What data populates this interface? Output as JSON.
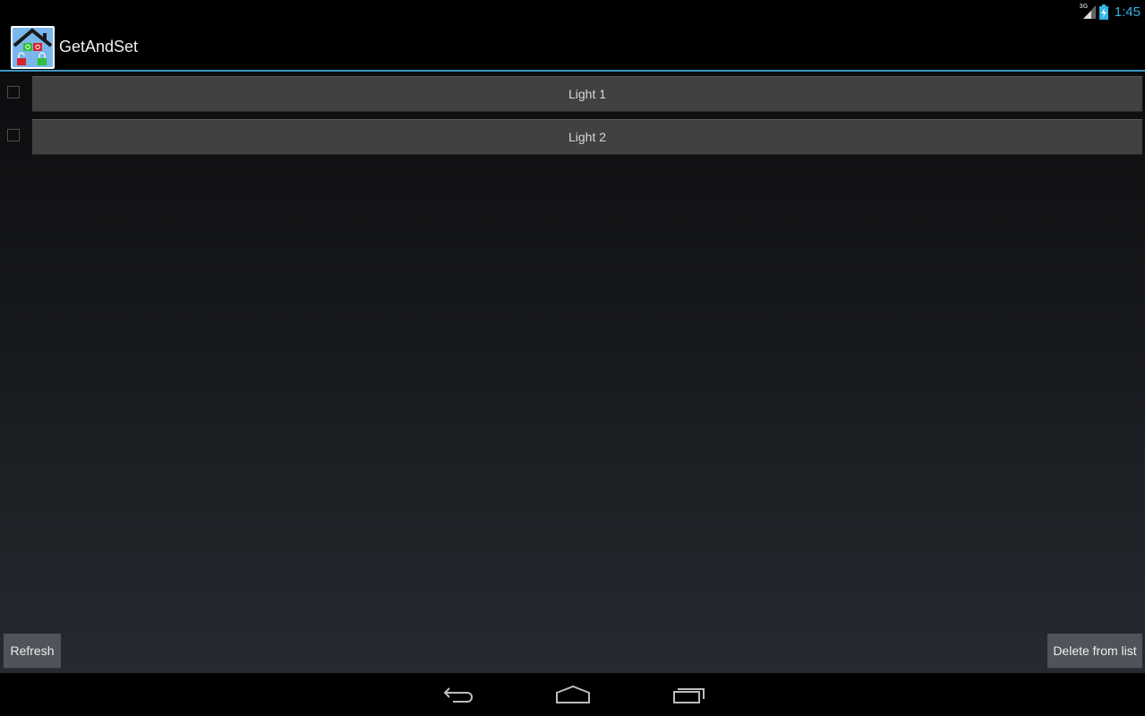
{
  "status_bar": {
    "network_type": "3G",
    "time": "1:45",
    "icons": [
      "signal-icon",
      "battery-charging-icon"
    ]
  },
  "action_bar": {
    "app_icon": "home-automation-app-icon",
    "title": "GetAndSet"
  },
  "list": {
    "items": [
      {
        "label": "Light 1",
        "checked": false
      },
      {
        "label": "Light 2",
        "checked": false
      }
    ]
  },
  "footer": {
    "refresh_label": "Refresh",
    "delete_label": "Delete from list"
  },
  "nav_bar": {
    "icons": [
      "back-icon",
      "home-icon",
      "recent-apps-icon"
    ]
  },
  "colors": {
    "accent": "#33b5e5",
    "action_bar_divider": "#3a97c4",
    "list_button_bg": "#414141",
    "footer_button_bg": "#50545a"
  }
}
